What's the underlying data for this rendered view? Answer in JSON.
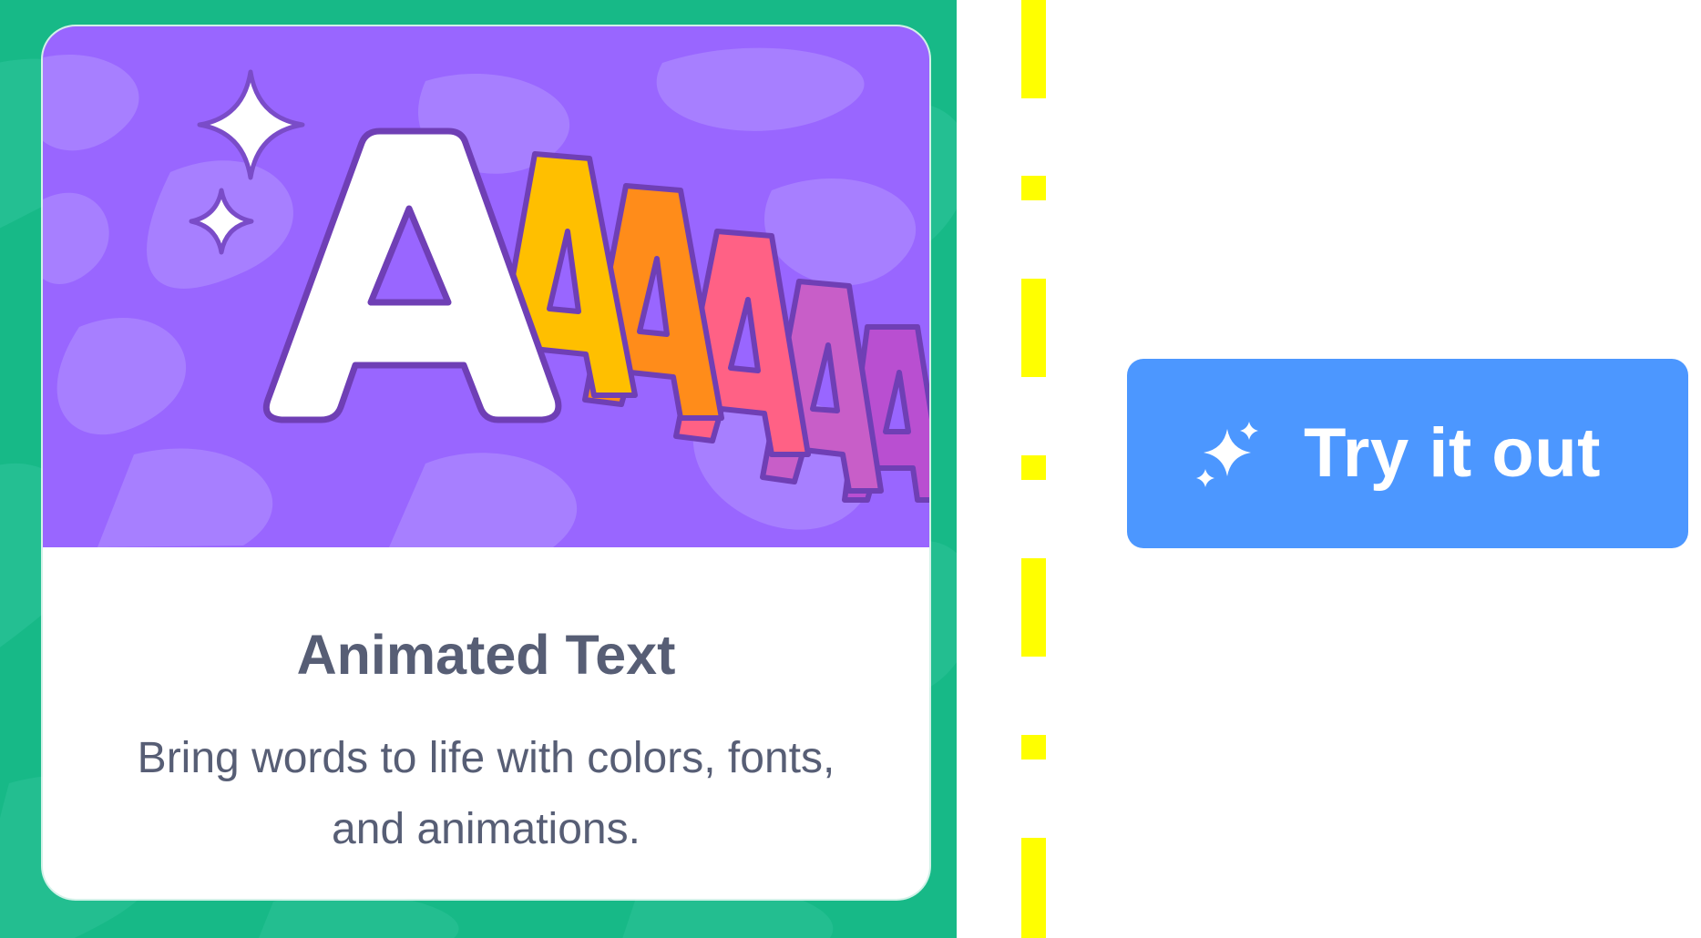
{
  "card": {
    "title": "Animated Text",
    "description": "Bring words to life with colors, fonts, and animations.",
    "image_icon": "animated-letters-illustration"
  },
  "button": {
    "label": "Try it out",
    "icon": "sparkles-icon"
  },
  "colors": {
    "panel_green": "#20b98c",
    "card_purple": "#9966ff",
    "button_blue": "#4c97ff",
    "divider_yellow": "#ffff00",
    "text_gray": "#575e75"
  }
}
